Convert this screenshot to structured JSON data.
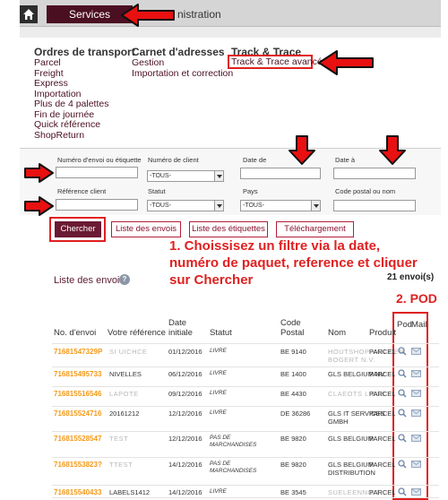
{
  "nav": {
    "home_icon": "home-icon",
    "services": "Services",
    "administration": "nistration"
  },
  "menu": {
    "col1": {
      "heading": "Ordres de transport",
      "items": [
        "Parcel",
        "Freight",
        "Express",
        "Importation",
        "Plus de 4 palettes",
        "Fin de journée",
        "Quick référence",
        "ShopReturn"
      ]
    },
    "col2": {
      "heading": "Carnet d'adresses",
      "items": [
        "Gestion",
        "Importation et correction"
      ]
    },
    "col3": {
      "heading": "Track & Trace",
      "items": [
        "Track & Trace avancé"
      ]
    }
  },
  "filters": {
    "envoi_label": "Numéro d'envoi ou étiquette",
    "client_label": "Numéro de client",
    "date_de_label": "Date de",
    "date_a_label": "Date à",
    "reference_label": "Référence client",
    "statut_label": "Statut",
    "pays_label": "Pays",
    "code_postal_label": "Code postal ou nom",
    "client_value": "-TOUS-",
    "statut_value": "-TOUS-",
    "pays_value": "-TOUS-"
  },
  "buttons": {
    "chercher": "Chercher",
    "liste_envois": "Liste des envois",
    "liste_etiquettes": "Liste des étiquettes",
    "telechargement": "Téléchargement"
  },
  "annotations": {
    "step1_line1": "1. Choissisez un filtre via la date,",
    "step1_line2": "numéro de paquet, reference et cliquer",
    "step1_line3": "sur Chercher",
    "step2": "2. POD"
  },
  "list": {
    "title": "Liste des envois",
    "count": "21 envoi(s)"
  },
  "table": {
    "headers": {
      "no": "No. d'envoi",
      "ref": "Votre référence",
      "date1": "Date",
      "date2": "initiale",
      "statut": "Statut",
      "code1": "Code",
      "code2": "Postal",
      "nom": "Nom",
      "produit": "Produit",
      "pod": "Pod",
      "mail": "Mail"
    },
    "rows": [
      {
        "no": "71681547329P",
        "ref": "SI UICHCE",
        "date": "01/12/2016",
        "statut1": "LIVRE",
        "statut2": "",
        "code": "BE 9140",
        "nom1": "HOUTSHOP VAN DER",
        "nom2": "BOGERT N.V.",
        "produit": "PARCEL"
      },
      {
        "no": "716815495733",
        "ref": "NIVELLES",
        "date": "06/12/2016",
        "statut1": "LIVRE",
        "statut2": "",
        "code": "BE 1400",
        "nom1": "GLS BELGIUM NV",
        "nom2": "",
        "produit": "PARCEL"
      },
      {
        "no": "716815516546",
        "ref": "LAPOTE",
        "date": "09/12/2016",
        "statut1": "LIVRE",
        "statut2": "",
        "code": "BE 4430",
        "nom1": "CLAEOTS LIEGE",
        "nom2": "",
        "produit": "PARCEL"
      },
      {
        "no": "716815524716",
        "ref": "20161212",
        "date": "12/12/2016",
        "statut1": "LIVRE",
        "statut2": "",
        "code": "DE 36286",
        "nom1": "GLS IT SERVICES",
        "nom2": "GMBH",
        "produit": "PARCEL"
      },
      {
        "no": "716815528547",
        "ref": "TEST",
        "date": "12/12/2016",
        "statut1": "PAS DE",
        "statut2": "MARCHANDISES",
        "code": "BE 9820",
        "nom1": "GLS BELGIUM",
        "nom2": "",
        "produit": "PARCEL"
      },
      {
        "no": "71681553823?",
        "ref": "TTEST",
        "date": "14/12/2016",
        "statut1": "PAS DE",
        "statut2": "MARCHANDISES",
        "code": "BE 9820",
        "nom1": "GLS BELGIUM",
        "nom2": "DISTRIBUTION",
        "produit": "PARCEL"
      },
      {
        "no": "716815540433",
        "ref": "LABELS1412",
        "date": "14/12/2016",
        "statut1": "LIVRE",
        "statut2": "",
        "code": "BE 3545",
        "nom1": "SUELEENNO.T",
        "nom2": "",
        "produit": "PARCEL"
      }
    ]
  },
  "colors": {
    "accent": "#6b1a33",
    "annotation_red": "#e02020",
    "shipment_number": "#f39a1a"
  }
}
